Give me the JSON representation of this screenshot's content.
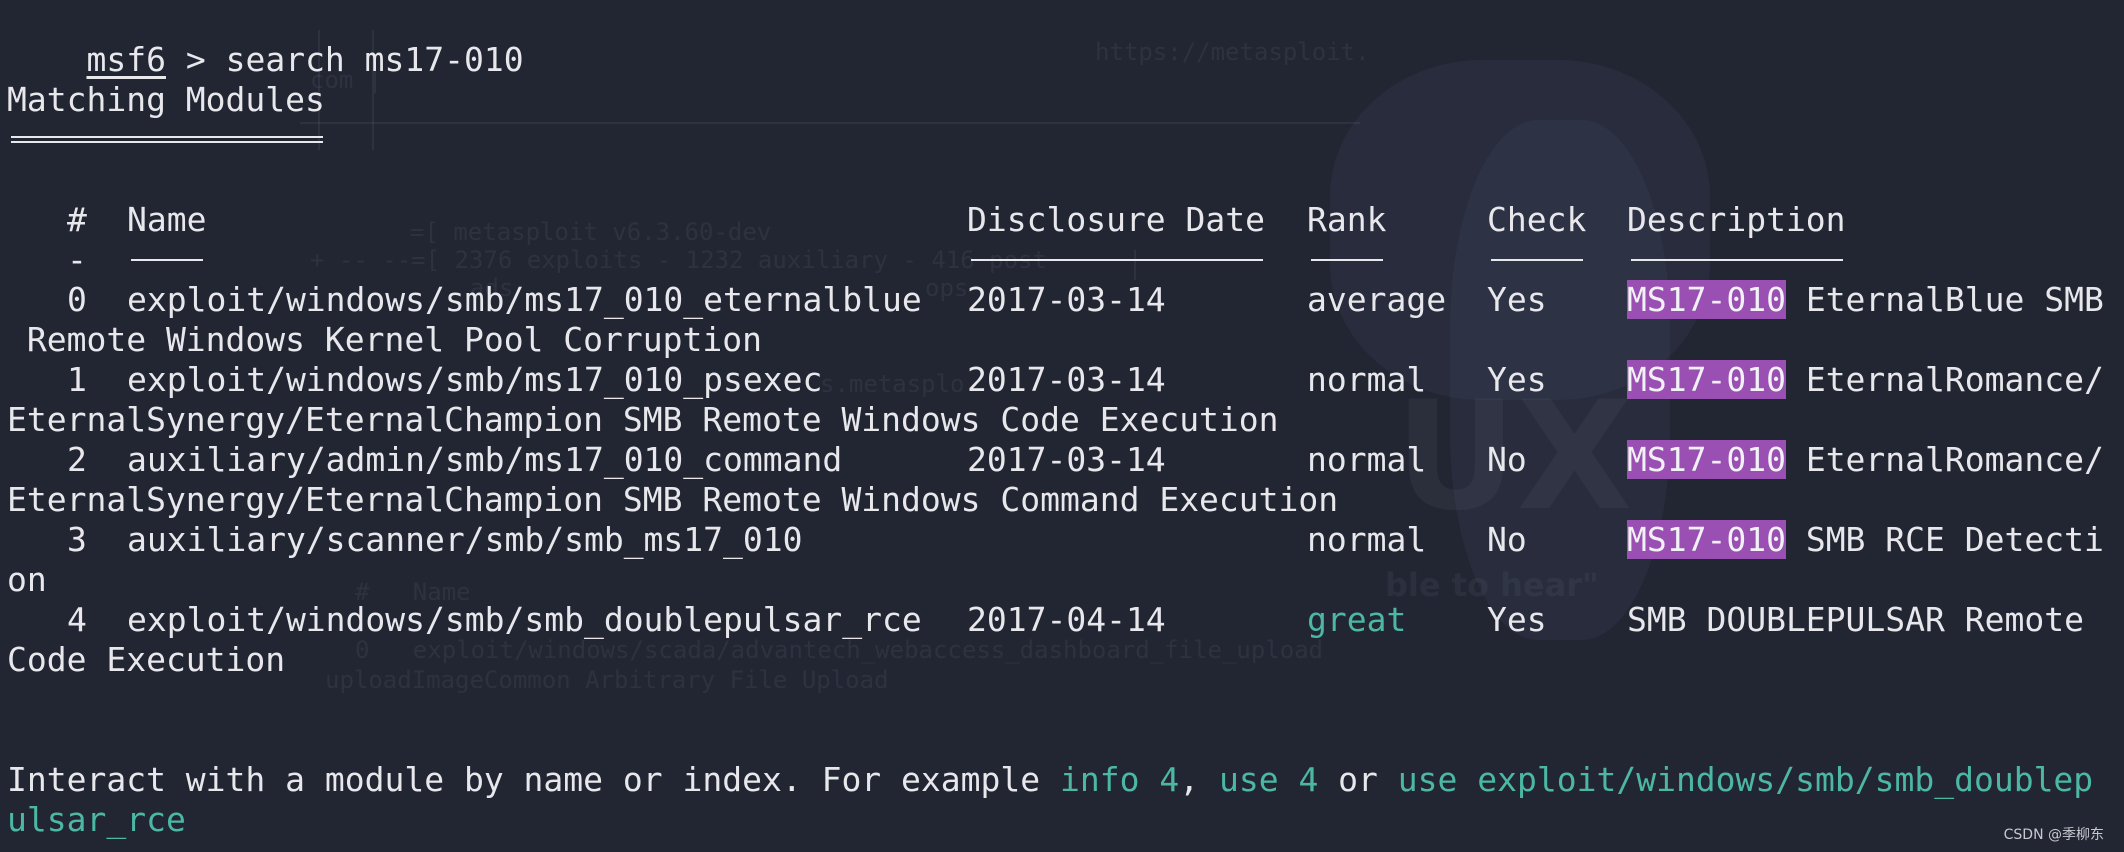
{
  "prompt": {
    "name": "msf6",
    "symbol": ">",
    "command": "search ms17-010"
  },
  "section_title": "Matching Modules",
  "table": {
    "headers": {
      "index": "#",
      "name": "Name",
      "date": "Disclosure Date",
      "rank": "Rank",
      "check": "Check",
      "description": "Description"
    },
    "header_dash": "-",
    "rows": [
      {
        "index": "0",
        "name": "exploit/windows/smb/ms17_010_eternalblue",
        "date": "2017-03-14",
        "rank": "average",
        "check": "Yes",
        "desc_highlight": "MS17-010",
        "desc_line1": " EternalBlue SMB",
        "desc_line2": " Remote Windows Kernel Pool Corruption"
      },
      {
        "index": "1",
        "name": "exploit/windows/smb/ms17_010_psexec",
        "date": "2017-03-14",
        "rank": "normal",
        "check": "Yes",
        "desc_highlight": "MS17-010",
        "desc_line1": " EternalRomance/",
        "desc_line2": "EternalSynergy/EternalChampion SMB Remote Windows Code Execution"
      },
      {
        "index": "2",
        "name": "auxiliary/admin/smb/ms17_010_command",
        "date": "2017-03-14",
        "rank": "normal",
        "check": "No",
        "desc_highlight": "MS17-010",
        "desc_line1": " EternalRomance/",
        "desc_line2": "EternalSynergy/EternalChampion SMB Remote Windows Command Execution"
      },
      {
        "index": "3",
        "name": "auxiliary/scanner/smb/smb_ms17_010",
        "date": "",
        "rank": "normal",
        "check": "No",
        "desc_highlight": "MS17-010",
        "desc_line1": " SMB RCE Detecti",
        "desc_line2": "on"
      },
      {
        "index": "4",
        "name": "exploit/windows/smb/smb_doublepulsar_rce",
        "date": "2017-04-14",
        "rank": "great",
        "check": "Yes",
        "desc_highlight": "",
        "desc_line1": "SMB DOUBLEPULSAR Remote",
        "desc_line2": "Code Execution"
      }
    ]
  },
  "footer": {
    "prefix": "Interact with a module by name or index. For example ",
    "ex1": "info 4",
    "sep1": ", ",
    "ex2": "use 4",
    "sep2": " or ",
    "ex3_line1": "use exploit/windows/smb/smb_doublep",
    "ex3_line2": "ulsar_rce"
  },
  "background": {
    "url": "https://metasploit.",
    "com_fragment": "com |",
    "banner_line1": "=[ metasploit v6.3.60-dev",
    "banner_line2": "+ -- --=[ 2376 exploits - 1232 auxiliary - 416 post",
    "banner_line3": "ads",
    "banner_line4": "ops",
    "banner_line5": "s.metasplo",
    "old_header": "#   Name",
    "old_row": "0   exploit/windows/scada/advantech_webaccess_dashboard_file_upload",
    "old_desc": "uploadImageCommon Arbitrary File Upload",
    "big_text": "UX",
    "slogan": "ble to hear\""
  },
  "watermark": "CSDN @季柳东",
  "colors": {
    "background": "#222633",
    "text": "#e8e8ec",
    "highlight_bg": "#9950b2",
    "accent_cyan": "#4cb8a4"
  }
}
